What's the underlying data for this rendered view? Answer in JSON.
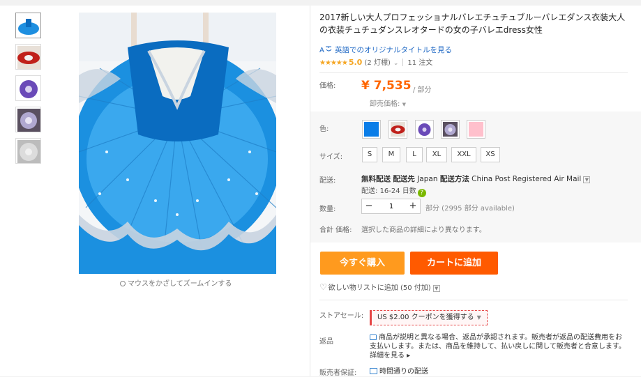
{
  "product": {
    "title": "2017新しい大人プロフェッショナルバレエチュチュブルーバレエダンス衣装大人の衣装チュチュダンスレオタードの女の子バレエdress女性",
    "translate_link": "英語でのオリジナルタイトルを見る",
    "rating": {
      "stars": "★★★★★",
      "score": "5.0",
      "votes": "(2 灯標)",
      "orders": "11 注文"
    }
  },
  "gallery": {
    "zoom_hint": "マウスをかざしてズームインする",
    "thumbs": [
      "blue-tutu",
      "red-tutu",
      "purple-tutu",
      "lilac-tutu",
      "white-tutu"
    ]
  },
  "price": {
    "label": "価格:",
    "value": "¥ 7,535",
    "unit": "/ 部分",
    "wholesale": "卸売価格:"
  },
  "options": {
    "color_label": "色:",
    "colors": [
      "#0a7de8",
      "#c0201a",
      "#6a4ab8",
      "#8f87a8",
      "#ffc0cc"
    ],
    "size_label": "サイズ:",
    "sizes": [
      "S",
      "M",
      "L",
      "XL",
      "XXL",
      "XS"
    ]
  },
  "shipping": {
    "label": "配送:",
    "free": "無料配送",
    "to_label": "配送先",
    "to": "Japan",
    "method_label": "配送方法",
    "method": "China Post Registered Air Mail",
    "time_prefix": "配送:",
    "time": "16-24 日数"
  },
  "quantity": {
    "label": "数量:",
    "value": "1",
    "available": "部分 (2995 部分 available)"
  },
  "total": {
    "label": "合計 価格:",
    "note": "選択した商品の詳細により異なります。"
  },
  "actions": {
    "buy_now": "今すぐ購入",
    "add_to_cart": "カートに追加",
    "wishlist": "欲しい物リストに追加 (50 付加)"
  },
  "store_sale": {
    "label": "ストアセール:",
    "coupon": "US $2.00 クーポンを獲得する"
  },
  "returns": {
    "label": "返品",
    "text": "商品が説明と異なる場合、返品が承認されます。販売者が返品の配送費用をお支払いします。または、商品を維持して、払い戻しに関して販売者と合意します。",
    "more": "詳細を見る ▸"
  },
  "guarantee": {
    "label": "販売者保証:",
    "text": "時間通りの配送"
  }
}
